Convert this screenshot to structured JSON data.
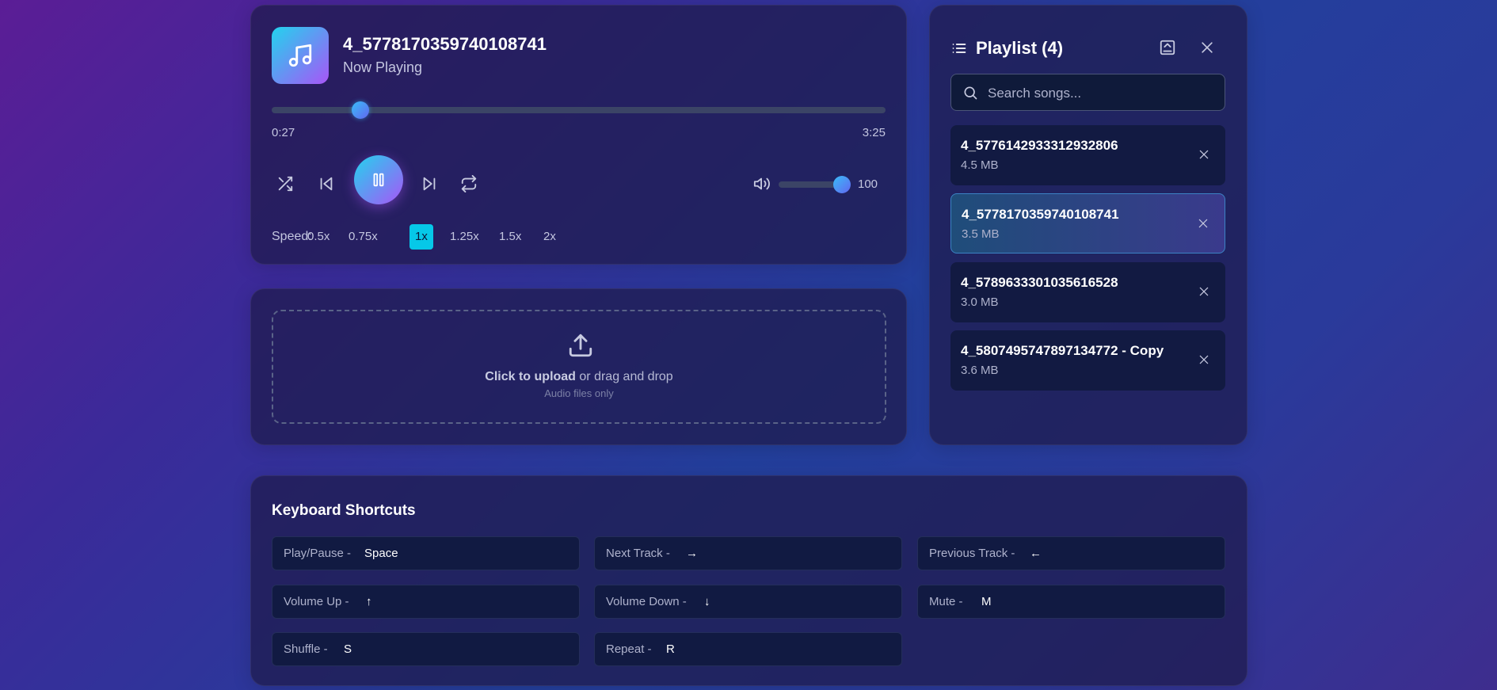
{
  "player": {
    "title": "4_5778170359740108741",
    "subtitle": "Now Playing",
    "progress_fraction": 0.144,
    "current_time": "0:27",
    "duration": "3:25",
    "volume": 100,
    "volume_label": "100",
    "speed_label": "Speed:",
    "speeds": [
      "0.5x",
      "0.75x",
      "1x",
      "1.25x",
      "1.5x",
      "2x"
    ],
    "active_speed": "1x",
    "icons": [
      "music-note-icon",
      "shuffle-icon",
      "previous-icon",
      "pause-icon",
      "next-icon",
      "repeat-icon",
      "volume-icon"
    ]
  },
  "upload": {
    "strong": "Click to upload",
    "rest": " or drag and drop",
    "hint": "Audio files only"
  },
  "playlist": {
    "title": "Playlist (4)",
    "search_placeholder": "Search songs...",
    "items": [
      {
        "name": "4_5776142933312932806",
        "size": "4.5 MB"
      },
      {
        "name": "4_5778170359740108741",
        "size": "3.5 MB"
      },
      {
        "name": "4_5789633301035616528",
        "size": "3.0 MB"
      },
      {
        "name": "4_5807495747897134772 - Copy",
        "size": "3.6 MB"
      }
    ],
    "active_index": 1
  },
  "shortcuts": {
    "title": "Keyboard Shortcuts",
    "items": [
      {
        "label": "Play/Pause -",
        "key": "Space"
      },
      {
        "label": "Next Track -",
        "key": "→"
      },
      {
        "label": "Previous Track -",
        "key": "←"
      },
      {
        "label": "Volume Up -",
        "key": "↑"
      },
      {
        "label": "Volume Down -",
        "key": "↓"
      },
      {
        "label": "Mute -",
        "key": "M"
      },
      {
        "label": "Shuffle -",
        "key": "S"
      },
      {
        "label": "Repeat -",
        "key": "R"
      }
    ]
  },
  "colors": {
    "accent_cyan": "#22d3ee",
    "accent_purple": "#a855f7",
    "speed_active": "#06c8e8"
  }
}
